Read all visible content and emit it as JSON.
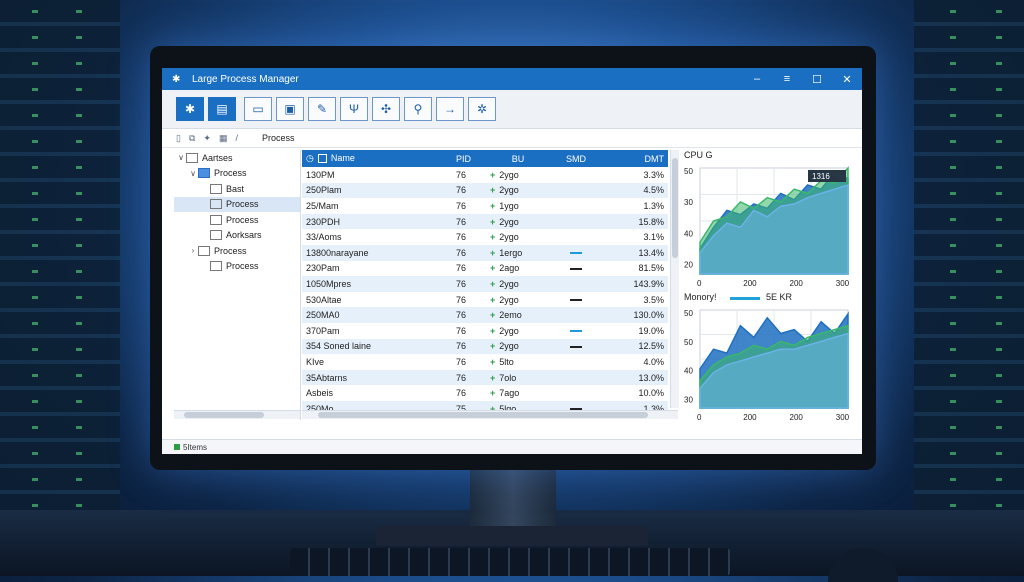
{
  "window": {
    "title": "Large Process Manager",
    "min": "–",
    "restore": "☐",
    "menu": "≡",
    "close": "✕"
  },
  "toolbar": {
    "buttons": [
      "gear-icon",
      "calendar-icon",
      "monitor-icon",
      "window-icon",
      "edit-icon",
      "filter-icon",
      "network-icon",
      "search-icon",
      "arrow-icon",
      "bug-icon"
    ]
  },
  "address": {
    "path": "Process"
  },
  "tree": {
    "items": [
      {
        "label": "Aartses",
        "depth": 0,
        "toggle": "∨",
        "icon": "doc",
        "selected": false
      },
      {
        "label": "Process",
        "depth": 1,
        "toggle": "∨",
        "icon": "folder",
        "selected": false
      },
      {
        "label": "Bast",
        "depth": 2,
        "toggle": "",
        "icon": "doc",
        "selected": false
      },
      {
        "label": "Process",
        "depth": 2,
        "toggle": "",
        "icon": "doc",
        "selected": true
      },
      {
        "label": "Process",
        "depth": 2,
        "toggle": "",
        "icon": "doc",
        "selected": false
      },
      {
        "label": "Aorksars",
        "depth": 2,
        "toggle": "",
        "icon": "doc",
        "selected": false
      },
      {
        "label": "Process",
        "depth": 1,
        "toggle": "›",
        "icon": "doc",
        "selected": false
      },
      {
        "label": "Process",
        "depth": 2,
        "toggle": "",
        "icon": "doc",
        "selected": false
      }
    ]
  },
  "table": {
    "headers": {
      "name": "Name",
      "pid": "PID",
      "bu": "BU",
      "smd": "SMD",
      "dmt": "DMT"
    },
    "rows": [
      {
        "name": "130PM",
        "pid": "76",
        "bu": "2ygo",
        "smd": "",
        "dmt": "3.3%"
      },
      {
        "name": "250Plam",
        "pid": "76",
        "bu": "2ygo",
        "smd": "",
        "dmt": "4.5%"
      },
      {
        "name": "25/Mam",
        "pid": "76",
        "bu": "1ygo",
        "smd": "",
        "dmt": "1.3%"
      },
      {
        "name": "230PDH",
        "pid": "76",
        "bu": "2ygo",
        "smd": "",
        "dmt": "15.8%"
      },
      {
        "name": "33/Aoms",
        "pid": "76",
        "bu": "2ygo",
        "smd": "",
        "dmt": "3.1%"
      },
      {
        "name": "13800narayane",
        "pid": "76",
        "bu": "1ergo",
        "smd": "blue",
        "dmt": "13.4%"
      },
      {
        "name": "230Pam",
        "pid": "76",
        "bu": "2ago",
        "smd": "dark",
        "dmt": "81.5%"
      },
      {
        "name": "1050Mpres",
        "pid": "76",
        "bu": "2ygo",
        "smd": "",
        "dmt": "143.9%"
      },
      {
        "name": "530Altae",
        "pid": "76",
        "bu": "2ygo",
        "smd": "dark",
        "dmt": "3.5%"
      },
      {
        "name": "250MA0",
        "pid": "76",
        "bu": "2emo",
        "smd": "",
        "dmt": "130.0%"
      },
      {
        "name": "370Pam",
        "pid": "76",
        "bu": "2ygo",
        "smd": "blue",
        "dmt": "19.0%"
      },
      {
        "name": "354 Soned laine",
        "pid": "76",
        "bu": "2ygo",
        "smd": "dark",
        "dmt": "12.5%"
      },
      {
        "name": "KIve",
        "pid": "76",
        "bu": "5lto",
        "smd": "",
        "dmt": "4.0%"
      },
      {
        "name": "35Abtarns",
        "pid": "76",
        "bu": "7olo",
        "smd": "",
        "dmt": "13.0%"
      },
      {
        "name": "Asbeis",
        "pid": "76",
        "bu": "7ago",
        "smd": "",
        "dmt": "10.0%"
      },
      {
        "name": "250Mo",
        "pid": "75",
        "bu": "5lgo",
        "smd": "dark",
        "dmt": "1.3%"
      }
    ]
  },
  "cpu_chart": {
    "title": "CPU G",
    "badge": "1316",
    "ylabels": [
      "50",
      "30",
      "40",
      "20"
    ],
    "xlabels": [
      "0",
      "200",
      "200",
      "300"
    ],
    "ylim": [
      0,
      50
    ],
    "series": [
      {
        "color": "#1f6fc1",
        "values": [
          12,
          22,
          30,
          28,
          33,
          31,
          38,
          35,
          42,
          40,
          48,
          45
        ]
      },
      {
        "color": "#3ab86a",
        "values": [
          15,
          25,
          27,
          34,
          31,
          36,
          34,
          40,
          38,
          44,
          43,
          50
        ]
      },
      {
        "color": "#6bb2e8",
        "values": [
          10,
          18,
          24,
          22,
          30,
          27,
          32,
          33,
          36,
          38,
          40,
          42
        ]
      }
    ]
  },
  "mem_chart": {
    "title": "Monory!",
    "legend": "5E KR",
    "legend_color": "#1fa3d9",
    "ylabels": [
      "50",
      "50",
      "40",
      "30"
    ],
    "xlabels": [
      "0",
      "200",
      "200",
      "300"
    ],
    "ylim": [
      0,
      50
    ],
    "series": [
      {
        "color": "#1f6fc1",
        "values": [
          20,
          30,
          28,
          42,
          36,
          46,
          38,
          40,
          34,
          44,
          38,
          48
        ]
      },
      {
        "color": "#3ab86a",
        "values": [
          14,
          22,
          26,
          28,
          32,
          30,
          34,
          32,
          36,
          38,
          40,
          42
        ]
      },
      {
        "color": "#6bb2e8",
        "values": [
          10,
          18,
          22,
          24,
          26,
          28,
          30,
          30,
          32,
          34,
          36,
          38
        ]
      }
    ]
  },
  "status": {
    "text": "5Items"
  }
}
